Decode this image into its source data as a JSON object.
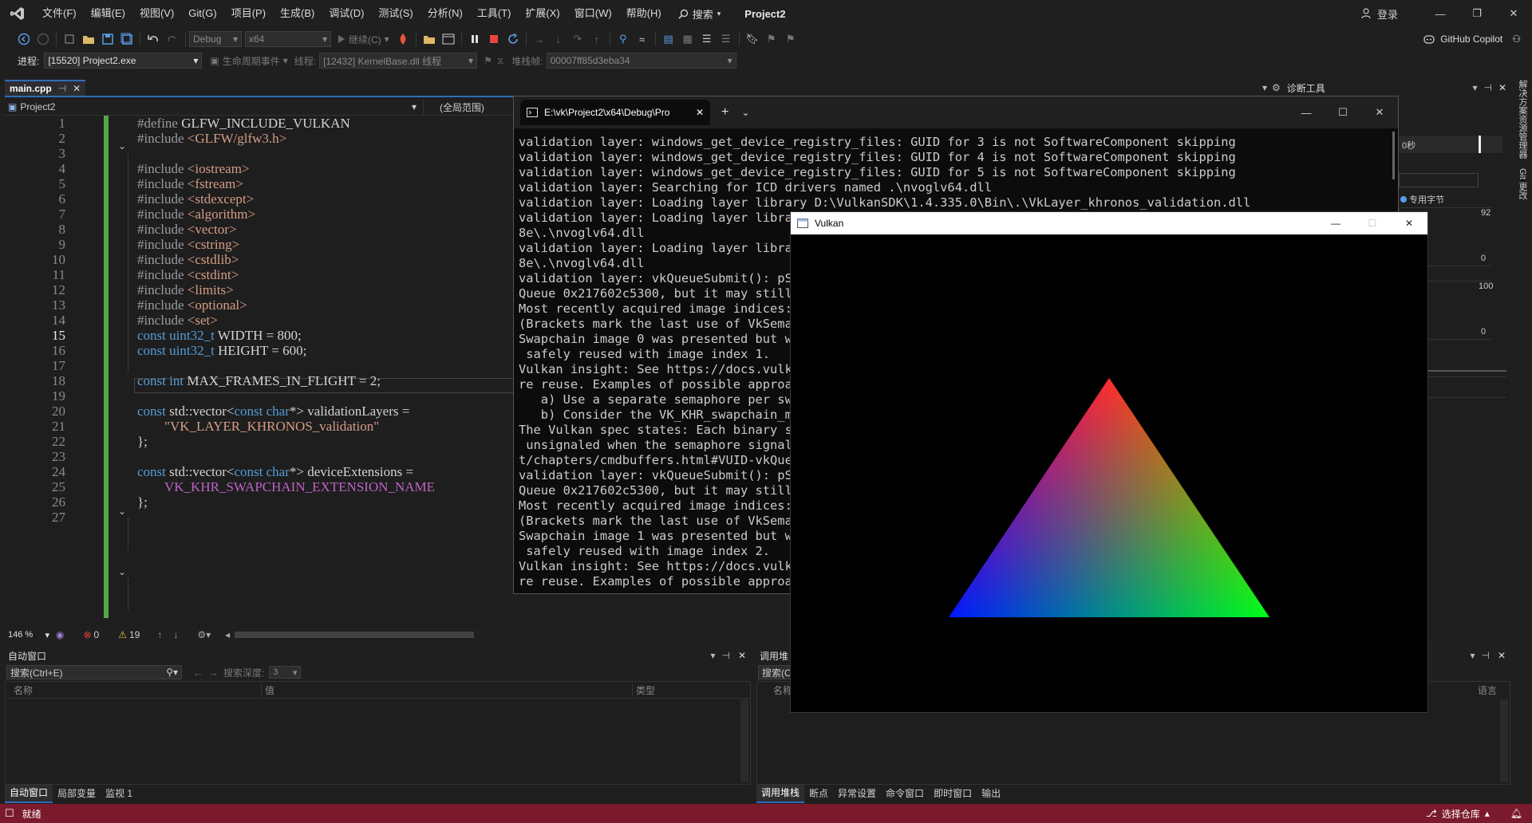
{
  "menubar": {
    "items": [
      "文件(F)",
      "编辑(E)",
      "视图(V)",
      "Git(G)",
      "项目(P)",
      "生成(B)",
      "调试(D)",
      "测试(S)",
      "分析(N)",
      "工具(T)",
      "扩展(X)",
      "窗口(W)",
      "帮助(H)"
    ],
    "search_label": "搜索",
    "solution_name": "Project2",
    "signin_label": "登录"
  },
  "toolbar": {
    "config": "Debug",
    "platform": "x64",
    "continue_label": "继续(C)",
    "copilot_label": "GitHub Copilot"
  },
  "debugbar": {
    "process_label": "进程:",
    "process_value": "[15520] Project2.exe",
    "lifecycle_label": "生命周期事件",
    "thread_label": "线程:",
    "thread_value": "[12432] KernelBase.dll 线程",
    "stackframe_label": "堆栈帧:",
    "stackframe_value": "00007ff85d3eba34"
  },
  "editor": {
    "tab_label": "main.cpp",
    "project_name": "Project2",
    "scope": "(全局范围)",
    "line_numbers": [
      "1",
      "2",
      "3",
      "4",
      "5",
      "6",
      "7",
      "8",
      "9",
      "10",
      "11",
      "12",
      "13",
      "14",
      "15",
      "16",
      "17",
      "18",
      "19",
      "20",
      "21",
      "22",
      "23",
      "24",
      "25",
      "26",
      "27"
    ],
    "current_line": "15",
    "code": {
      "l1_pp": "#define",
      "l1_rest": " GLFW_INCLUDE_VULKAN",
      "l2_pp": "#include",
      "l2_inc": " <GLFW/glfw3.h>",
      "includes": [
        " <iostream>",
        " <fstream>",
        " <stdexcept>",
        " <algorithm>",
        " <vector>",
        " <cstring>",
        " <cstdlib>",
        " <cstdint>",
        " <limits>",
        " <optional>",
        " <set>"
      ],
      "include_kw": "#include",
      "const_kw": "const",
      "uint32_t": "uint32_t",
      "int_kw": "int",
      "char_kw": "char",
      "l16_rest": " WIDTH = 800;",
      "l17_rest": " HEIGHT = 600;",
      "l19_rest": " MAX_FRAMES_IN_FLIGHT = 2;",
      "std_vector": " std::vector<",
      "ptr_close": "*>",
      "l21_rest": " validationLayers =",
      "l22_str": "\"VK_LAYER_KHRONOS_validation\"",
      "close_brace": "};",
      "l25_rest": " deviceExtensions =",
      "l26_mac": "VK_KHR_SWAPCHAIN_EXTENSION_NAME"
    },
    "zoom": "146 %",
    "errors": "0",
    "warnings": "19"
  },
  "autos_panel": {
    "title": "自动窗口",
    "search_placeholder": "搜索(Ctrl+E)",
    "search_depth_label": "搜索深度:",
    "search_depth_value": "3",
    "col_name": "名称",
    "col_value": "值",
    "col_type": "类型",
    "tabs": [
      "自动窗口",
      "局部变量",
      "监视 1"
    ]
  },
  "callstack_panel": {
    "title": "调用堆",
    "search_placeholder": "搜索(C",
    "col_name": "名称",
    "col_lang": "语言",
    "tabs": [
      "调用堆栈",
      "断点",
      "异常设置",
      "命令窗口",
      "即时窗口",
      "输出"
    ]
  },
  "diagnostics": {
    "title": "诊断工具",
    "seconds_label": "0秒",
    "private_bytes_label": "专用字节",
    "mem_max": "92",
    "mem_min": "0",
    "cpu_max": "100",
    "cpu_min": "0",
    "tab_fragment": "态"
  },
  "side_tabs": {
    "solution_explorer": "解决方案资源管理器",
    "git_changes": "Git 更改"
  },
  "console": {
    "tab_title": "E:\\vk\\Project2\\x64\\Debug\\Pro",
    "lines": [
      "validation layer: windows_get_device_registry_files: GUID for 3 is not SoftwareComponent skipping",
      "validation layer: windows_get_device_registry_files: GUID for 4 is not SoftwareComponent skipping",
      "validation layer: windows_get_device_registry_files: GUID for 5 is not SoftwareComponent skipping",
      "validation layer: Searching for ICD drivers named .\\nvoglv64.dll",
      "validation layer: Loading layer library D:\\VulkanSDK\\1.4.335.0\\Bin\\.\\VkLayer_khronos_validation.dll",
      "validation layer: Loading layer librar",
      "8e\\.\\nvoglv64.dll",
      "validation layer: Loading layer librar",
      "8e\\.\\nvoglv64.dll",
      "validation layer: vkQueueSubmit(): pSu",
      "Queue 0x217602c5300, but it may still ",
      "Most recently acquired image indices: ",
      "(Brackets mark the last use of VkSemap",
      "Swapchain image 0 was presented but wa",
      " safely reused with image index 1.",
      "Vulkan insight: See https://docs.vulka",
      "re reuse. Examples of possible approac",
      "   a) Use a separate semaphore per swa",
      "   b) Consider the VK_KHR_swapchain_ma",
      "The Vulkan spec states: Each binary se",
      " unsignaled when the semaphore signal ",
      "t/chapters/cmdbuffers.html#VUID-vkQueu",
      "validation layer: vkQueueSubmit(): pSu",
      "Queue 0x217602c5300, but it may still ",
      "Most recently acquired image indices: ",
      "(Brackets mark the last use of VkSemap",
      "Swapchain image 1 was presented but wa",
      " safely reused with image index 2.",
      "Vulkan insight: See https://docs.vulka",
      "re reuse. Examples of possible approac"
    ]
  },
  "vulkan_window": {
    "title": "Vulkan",
    "vertex_colors": [
      "#ff0000",
      "#00ff00",
      "#0000ff"
    ]
  },
  "statusbar": {
    "state": "就绪",
    "repo": "选择仓库"
  },
  "colors": {
    "accent": "#2f6bb8",
    "statusbar": "#7a1a2c",
    "green_margin": "#57a64a"
  }
}
